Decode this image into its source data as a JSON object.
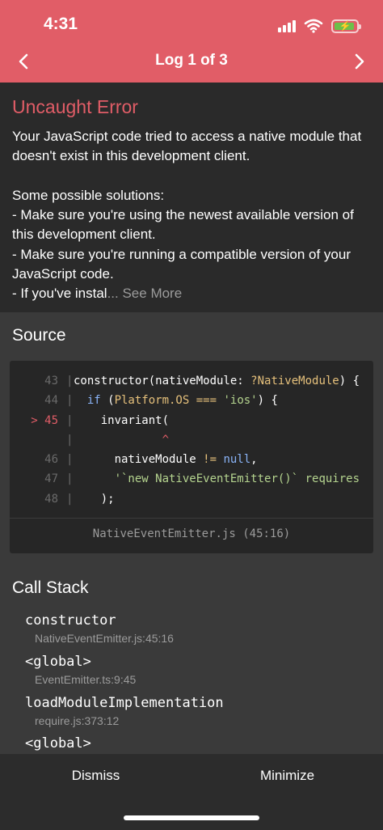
{
  "status_bar": {
    "time": "4:31"
  },
  "header": {
    "title": "Log 1 of 3",
    "prev_icon": "chevron-left-icon",
    "next_icon": "chevron-right-icon"
  },
  "error": {
    "title": "Uncaught Error",
    "message": "Your JavaScript code tried to access a native module that doesn't exist in this development client.\n\nSome possible solutions:\n- Make sure you're using the newest available version of this development client.\n- Make sure you're running a compatible version of your JavaScript code.\n- If you've instal",
    "truncation": "... See More"
  },
  "source": {
    "title": "Source",
    "lines": [
      {
        "num": "43",
        "marker": "",
        "gutter": "|",
        "text": "constructor(nativeModule: ?NativeModule) {"
      },
      {
        "num": "44",
        "marker": "",
        "gutter": "|",
        "text": "  if (Platform.OS === 'ios') {"
      },
      {
        "num": "45",
        "marker": ">",
        "gutter": "|",
        "text": "    invariant("
      },
      {
        "num": "",
        "marker": "",
        "gutter": "|",
        "text": "             ^"
      },
      {
        "num": "46",
        "marker": "",
        "gutter": "|",
        "text": "      nativeModule != null,"
      },
      {
        "num": "47",
        "marker": "",
        "gutter": "|",
        "text": "      '`new NativeEventEmitter()` requires"
      },
      {
        "num": "48",
        "marker": "",
        "gutter": "|",
        "text": "    );"
      }
    ],
    "file": "NativeEventEmitter.js (45:16)"
  },
  "call_stack": {
    "title": "Call Stack",
    "frames": [
      {
        "name": "constructor",
        "location": "NativeEventEmitter.js:45:16"
      },
      {
        "name": "<global>",
        "location": "EventEmitter.ts:9:45"
      },
      {
        "name": "loadModuleImplementation",
        "location": "require.js:373:12"
      },
      {
        "name": "<global>",
        "location": ""
      }
    ]
  },
  "footer": {
    "dismiss": "Dismiss",
    "minimize": "Minimize"
  },
  "colors": {
    "accent": "#e15d67",
    "background": "#2b2b2b",
    "panel": "#3a3a3a",
    "code_bg": "#262626"
  }
}
